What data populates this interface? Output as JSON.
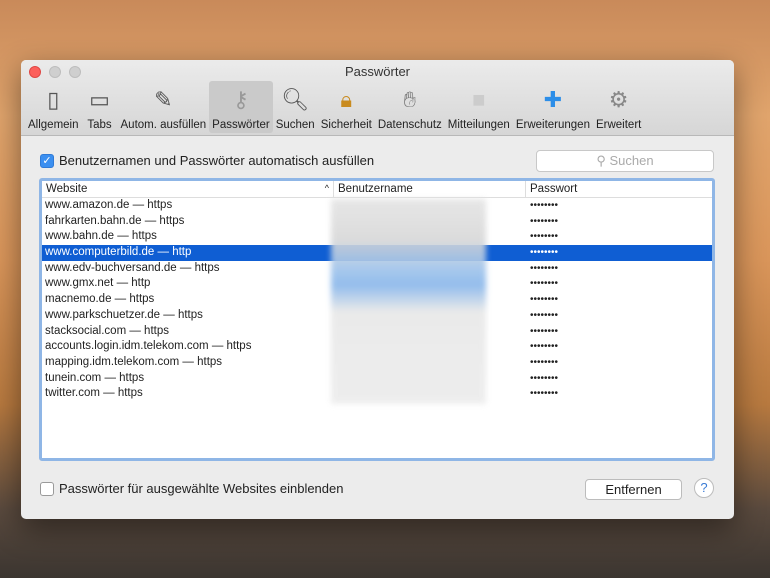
{
  "window": {
    "title": "Passwörter"
  },
  "toolbar": [
    {
      "label": "Allgemein",
      "icon": "switch-icon"
    },
    {
      "label": "Tabs",
      "icon": "tabs-icon"
    },
    {
      "label": "Autom. ausfüllen",
      "icon": "pencil-icon"
    },
    {
      "label": "Passwörter",
      "icon": "key-icon",
      "active": true
    },
    {
      "label": "Suchen",
      "icon": "magnifier-icon"
    },
    {
      "label": "Sicherheit",
      "icon": "lock-icon"
    },
    {
      "label": "Datenschutz",
      "icon": "hand-icon"
    },
    {
      "label": "Mitteilungen",
      "icon": "notification-icon"
    },
    {
      "label": "Erweiterungen",
      "icon": "puzzle-icon"
    },
    {
      "label": "Erweitert",
      "icon": "gear-icon"
    }
  ],
  "autofill": {
    "label": "Benutzernamen und Passwörter automatisch ausfüllen",
    "checked": true
  },
  "search": {
    "placeholder": "Suchen"
  },
  "table": {
    "headers": [
      "Website",
      "Benutzername",
      "Passwort"
    ],
    "rows": [
      {
        "site": "www.amazon.de — https",
        "pw": "••••••••"
      },
      {
        "site": "fahrkarten.bahn.de — https",
        "pw": "••••••••"
      },
      {
        "site": "www.bahn.de — https",
        "pw": "••••••••"
      },
      {
        "site": "www.computerbild.de — http",
        "pw": "••••••••",
        "selected": true
      },
      {
        "site": "www.edv-buchversand.de — https",
        "pw": "••••••••"
      },
      {
        "site": "www.gmx.net — http",
        "pw": "••••••••"
      },
      {
        "site": "macnemo.de — https",
        "pw": "••••••••"
      },
      {
        "site": "www.parkschuetzer.de — https",
        "pw": "••••••••"
      },
      {
        "site": "stacksocial.com — https",
        "pw": "••••••••"
      },
      {
        "site": "accounts.login.idm.telekom.com — https",
        "pw": "••••••••"
      },
      {
        "site": "mapping.idm.telekom.com — https",
        "pw": "••••••••"
      },
      {
        "site": "tunein.com — https",
        "pw": "••••••••"
      },
      {
        "site": "twitter.com — https",
        "pw": "••••••••"
      }
    ]
  },
  "show_passwords": {
    "label": "Passwörter für ausgewählte Websites einblenden",
    "checked": false
  },
  "remove_button": "Entfernen",
  "help": "?"
}
